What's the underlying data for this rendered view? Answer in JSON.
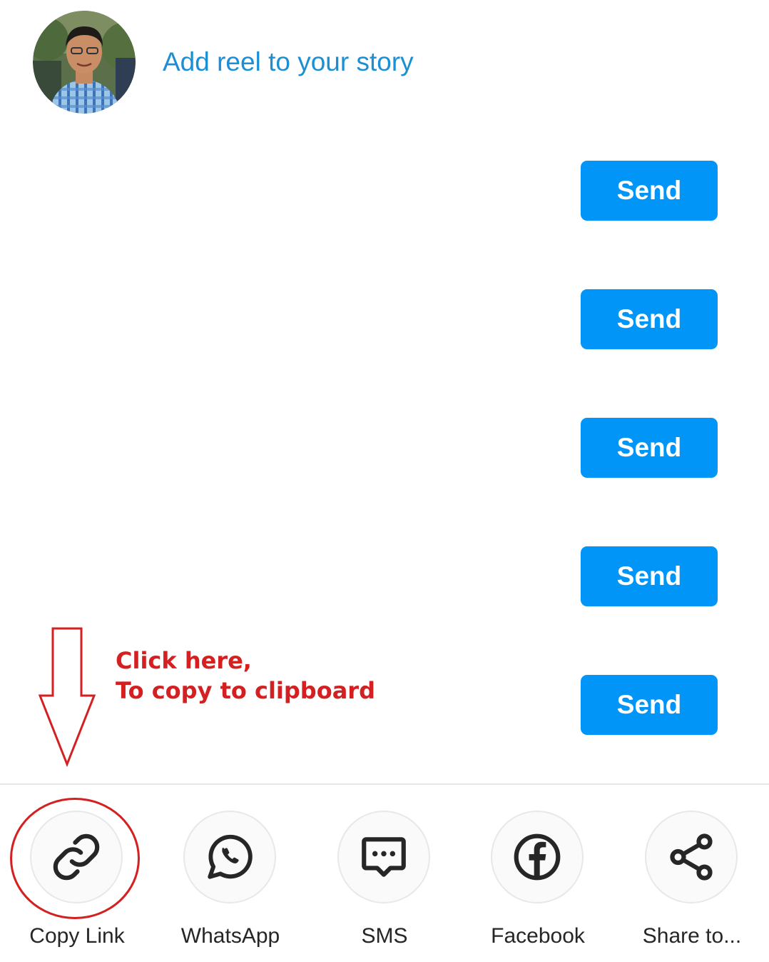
{
  "story": {
    "link_text": "Add reel to your story",
    "link_color": "#1a8fd6"
  },
  "send_buttons": [
    {
      "label": "Send"
    },
    {
      "label": "Send"
    },
    {
      "label": "Send"
    },
    {
      "label": "Send"
    },
    {
      "label": "Send"
    }
  ],
  "share_options": [
    {
      "label": "Copy Link",
      "icon": "link-icon"
    },
    {
      "label": "WhatsApp",
      "icon": "whatsapp-icon"
    },
    {
      "label": "SMS",
      "icon": "sms-icon"
    },
    {
      "label": "Facebook",
      "icon": "facebook-icon"
    },
    {
      "label": "Share to...",
      "icon": "share-icon"
    }
  ],
  "annotation": {
    "line1": "Click here,",
    "line2": "To copy to clipboard",
    "color": "#d42020"
  },
  "colors": {
    "send_button": "#0095f6",
    "icon_stroke": "#262626"
  }
}
